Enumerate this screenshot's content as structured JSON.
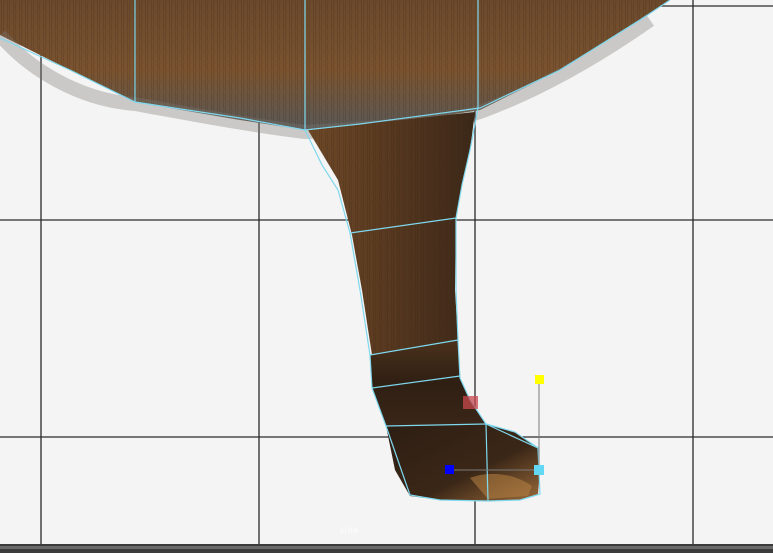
{
  "viewport": {
    "view_label": "side",
    "background": "#f4f4f4",
    "grid_color": "#2a2a2a",
    "wireframe_color": "#7fd8ee"
  },
  "handles": [
    {
      "name": "rotation-handle",
      "color": "#ff0",
      "icon": "square-handle"
    },
    {
      "name": "pivot-handle",
      "color": "#0000ff",
      "icon": "square-handle"
    },
    {
      "name": "scale-handle",
      "color": "#63d8f4",
      "icon": "square-handle"
    },
    {
      "name": "selected-vertex-handle",
      "color": "#c8484d",
      "icon": "square-handle"
    }
  ],
  "texture": {
    "subject": "dog-leg-fur",
    "fur_colors": [
      "#5a3c22",
      "#8a5a2c",
      "#3a2617",
      "#b7833f"
    ]
  }
}
